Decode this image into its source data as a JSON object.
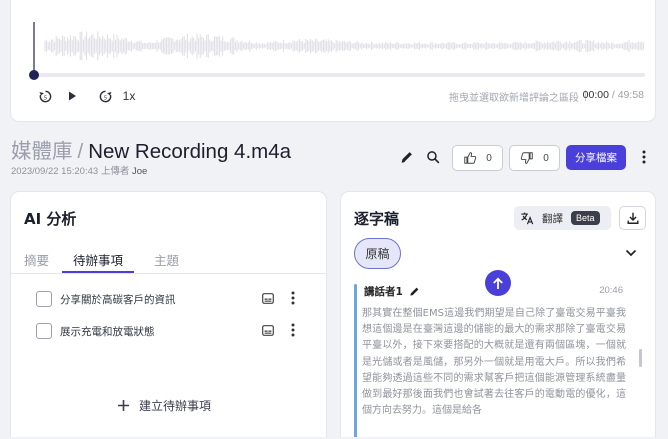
{
  "player": {
    "speed": "1x",
    "hint": "拖曳並選取欲新增評論之區段",
    "current_time": "00:00",
    "duration": "49:58",
    "progress_fraction": 0,
    "icons": [
      "rewind-icon",
      "play-icon",
      "forward-icon"
    ]
  },
  "header": {
    "breadcrumb_root": "媒體庫",
    "breadcrumb_sep": "/",
    "file_name": "New Recording 4.m4a",
    "uploaded_at": "2023/09/22 15:20:43",
    "uploaded_by_label": "上傳者",
    "uploader": "Joe",
    "like_count": "0",
    "dislike_count": "0",
    "share_label": "分享檔案"
  },
  "ai_panel": {
    "title": "AI 分析",
    "tabs": [
      {
        "label": "摘要",
        "active": false
      },
      {
        "label": "待辦事項",
        "active": true
      },
      {
        "label": "主題",
        "active": false
      }
    ],
    "todos": [
      {
        "text": "分享關於高碳客戶的資訊",
        "checked": false
      },
      {
        "text": "展示充電和放電狀態",
        "checked": false
      }
    ],
    "add_label": "建立待辦事項"
  },
  "transcript": {
    "title": "逐字稿",
    "translate_label": "翻譯",
    "beta_label": "Beta",
    "original_label": "原稿",
    "segments": [
      {
        "speaker": "講話者1",
        "time": "20:46",
        "text": "那其實在整個EMS這邊我們期望是自己除了臺電交易平臺我想這個邊是在臺灣這邊的儲能的最大的需求那除了臺電交易平臺以外，接下來要搭配的大概就是還有兩個區塊，一個就是光儲或者是風儲，那另外一個就是用電大戶。所以我們希望能夠透過這些不同的需求幫客戶把這個能源管理系統盡量做到最好那後面我們也會試著去往客戶的電動電的優化，這個方向去努力。這個是給各"
      }
    ]
  },
  "colors": {
    "accent": "#4a3fd8",
    "segment_bar": "#6fa4e3",
    "page_bg": "#f1f2f5"
  }
}
